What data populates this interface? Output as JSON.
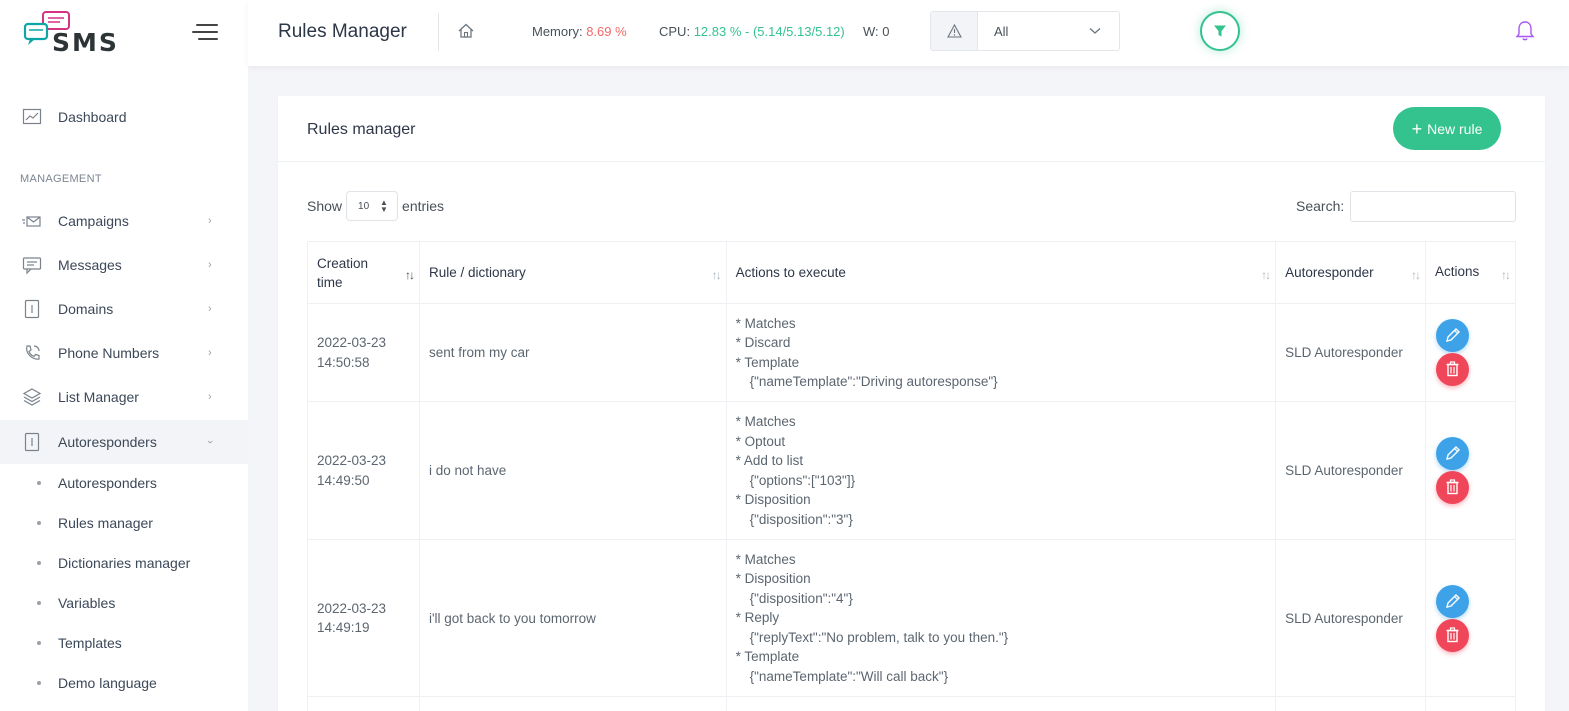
{
  "app": {
    "logo_text": "SMS"
  },
  "sidebar": {
    "dashboard": "Dashboard",
    "section_title": "MANAGEMENT",
    "items": [
      {
        "label": "Campaigns",
        "icon": "envelope-send-icon"
      },
      {
        "label": "Messages",
        "icon": "message-icon"
      },
      {
        "label": "Domains",
        "icon": "document-icon"
      },
      {
        "label": "Phone Numbers",
        "icon": "phone-icon"
      },
      {
        "label": "List Manager",
        "icon": "layers-icon"
      },
      {
        "label": "Autoresponders",
        "icon": "document-icon"
      }
    ],
    "sub_items": [
      "Autoresponders",
      "Rules manager",
      "Dictionaries manager",
      "Variables",
      "Templates",
      "Demo language"
    ]
  },
  "header": {
    "title": "Rules Manager",
    "memory_label": "Memory:",
    "memory_value": "8.69 %",
    "cpu_label": "CPU:",
    "cpu_value": "12.83 % - (5.14/5.13/5.12)",
    "w_label": "W: 0",
    "select_value": "All",
    "colors": {
      "memory": "#f46a6a",
      "cpu": "#34c38f",
      "accent": "#34c38f",
      "bell": "#a855f7"
    }
  },
  "card": {
    "title": "Rules manager",
    "new_rule_label": "New rule",
    "show_label": "Show",
    "entries_label": "entries",
    "page_length": "10",
    "search_label": "Search:",
    "search_value": ""
  },
  "table": {
    "columns": [
      "Creation time",
      "Rule / dictionary",
      "Actions to execute",
      "Autoresponder",
      "Actions"
    ],
    "rows": [
      {
        "date": "2022-03-23",
        "time": "14:50:58",
        "rule": "sent from my car",
        "actions": [
          "* Matches",
          "* Discard",
          "* Template",
          "{\"nameTemplate\":\"Driving autoresponse\"}"
        ],
        "autoresponder": "SLD Autoresponder"
      },
      {
        "date": "2022-03-23",
        "time": "14:49:50",
        "rule": "i do not have",
        "actions": [
          "* Matches",
          "* Optout",
          "* Add to list",
          "{\"options\":[\"103\"]}",
          "* Disposition",
          "{\"disposition\":\"3\"}"
        ],
        "autoresponder": "SLD Autoresponder"
      },
      {
        "date": "2022-03-23",
        "time": "14:49:19",
        "rule": "i'll got back to you tomorrow",
        "actions": [
          "* Matches",
          "* Disposition",
          "{\"disposition\":\"4\"}",
          "* Reply",
          "{\"replyText\":\"No problem, talk to you then.\"}",
          "* Template",
          "{\"nameTemplate\":\"Will call back\"}"
        ],
        "autoresponder": "SLD Autoresponder"
      }
    ]
  }
}
